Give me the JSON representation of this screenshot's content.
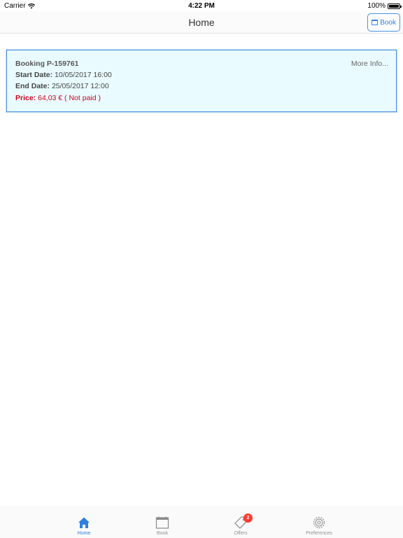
{
  "status_bar": {
    "carrier": "Carrier",
    "time": "4:22 PM",
    "battery": "100%"
  },
  "nav": {
    "title": "Home",
    "book_button": "Book"
  },
  "booking": {
    "title": "Booking P-159761",
    "start_label": "Start Date:",
    "start_value": "10/05/2017 16:00",
    "end_label": "End Date:",
    "end_value": "25/05/2017 12:00",
    "price_label": "Price:",
    "price_value": "64,03 € ( Not paid )",
    "more_info": "More Info..."
  },
  "tabs": [
    {
      "label": "Home",
      "icon": "house-icon",
      "active": true
    },
    {
      "label": "Book",
      "icon": "calendar-icon",
      "active": false
    },
    {
      "label": "Offers",
      "icon": "tag-icon",
      "active": false,
      "badge": "2"
    },
    {
      "label": "Preferences",
      "icon": "gear-icon",
      "active": false
    }
  ],
  "colors": {
    "accent": "#2f7fe0",
    "card_background": "#e9fbff",
    "card_border": "#4a90e2",
    "price": "#d0021b",
    "badge": "#ff3b30"
  }
}
